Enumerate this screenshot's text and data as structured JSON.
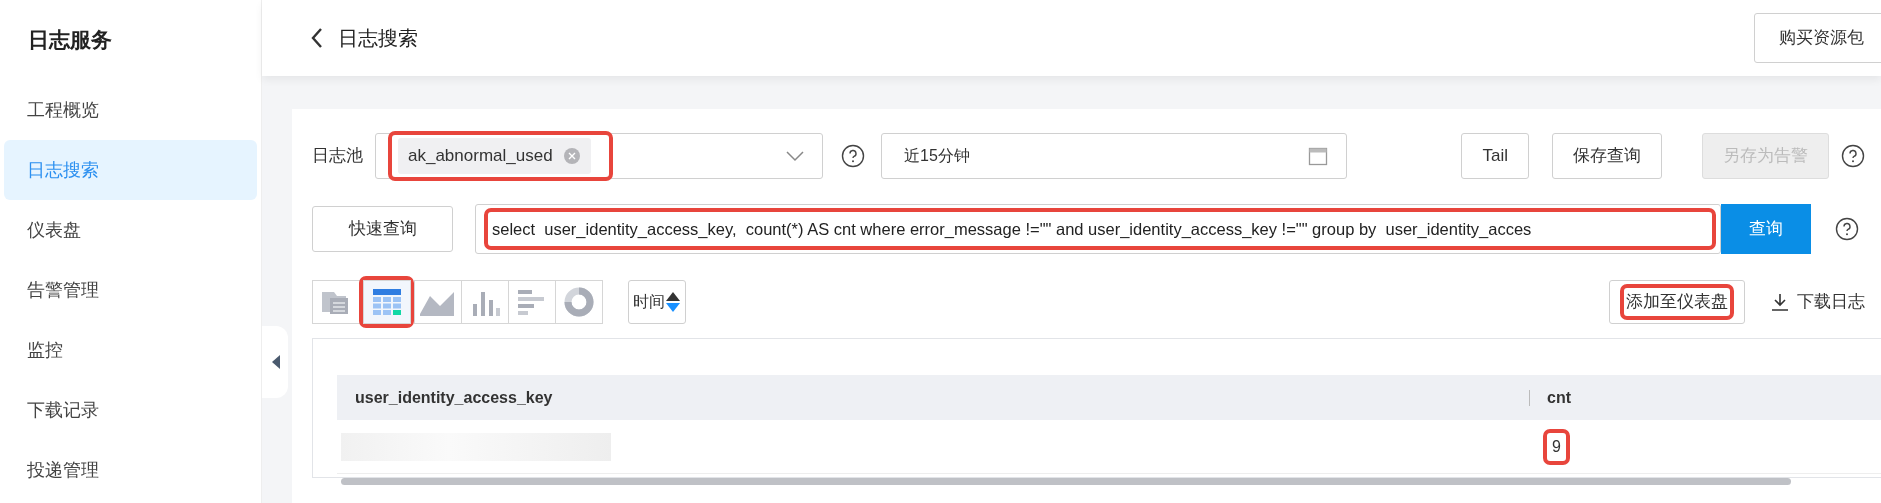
{
  "sidebar": {
    "title": "日志服务",
    "items": [
      {
        "label": "工程概览",
        "selected": false
      },
      {
        "label": "日志搜索",
        "selected": true
      },
      {
        "label": "仪表盘",
        "selected": false
      },
      {
        "label": "告警管理",
        "selected": false
      },
      {
        "label": "监控",
        "selected": false
      },
      {
        "label": "下载记录",
        "selected": false
      },
      {
        "label": "投递管理",
        "selected": false
      }
    ]
  },
  "header": {
    "title": "日志搜索",
    "buy_button": "购买资源包"
  },
  "filters": {
    "log_pool_label": "日志池",
    "log_pool_tag": {
      "label": "ak_abnormal_used",
      "annotated": true
    },
    "time_range": "近15分钟",
    "buttons": [
      {
        "label": "Tail",
        "disabled": false
      },
      {
        "label": "保存查询",
        "disabled": false
      },
      {
        "label": "另存为告警",
        "disabled": true
      }
    ]
  },
  "query": {
    "quick_button": "快速查询",
    "value": "select  user_identity_access_key,  count(*) AS cnt where error_message !=\"\" and user_identity_access_key !=\"\" group by  user_identity_acces",
    "annotated": true,
    "submit": "查询"
  },
  "view_toolbar": {
    "views": [
      {
        "kind": "raw",
        "selected": false,
        "annotated": false
      },
      {
        "kind": "table",
        "selected": true,
        "annotated": true
      },
      {
        "kind": "line",
        "selected": false,
        "annotated": false
      },
      {
        "kind": "bar",
        "selected": false,
        "annotated": false
      },
      {
        "kind": "hbar",
        "selected": false,
        "annotated": false
      },
      {
        "kind": "donut",
        "selected": false,
        "annotated": false
      }
    ],
    "sort_button": "时间",
    "add_dashboard": {
      "label": "添加至仪表盘",
      "annotated": true
    },
    "download": "下载日志"
  },
  "table": {
    "columns": [
      "user_identity_access_key",
      "cnt"
    ],
    "rows": [
      {
        "cells": [
          {
            "kind": "redacted"
          },
          {
            "kind": "text",
            "text": "9",
            "annotated": true
          }
        ]
      }
    ]
  }
}
